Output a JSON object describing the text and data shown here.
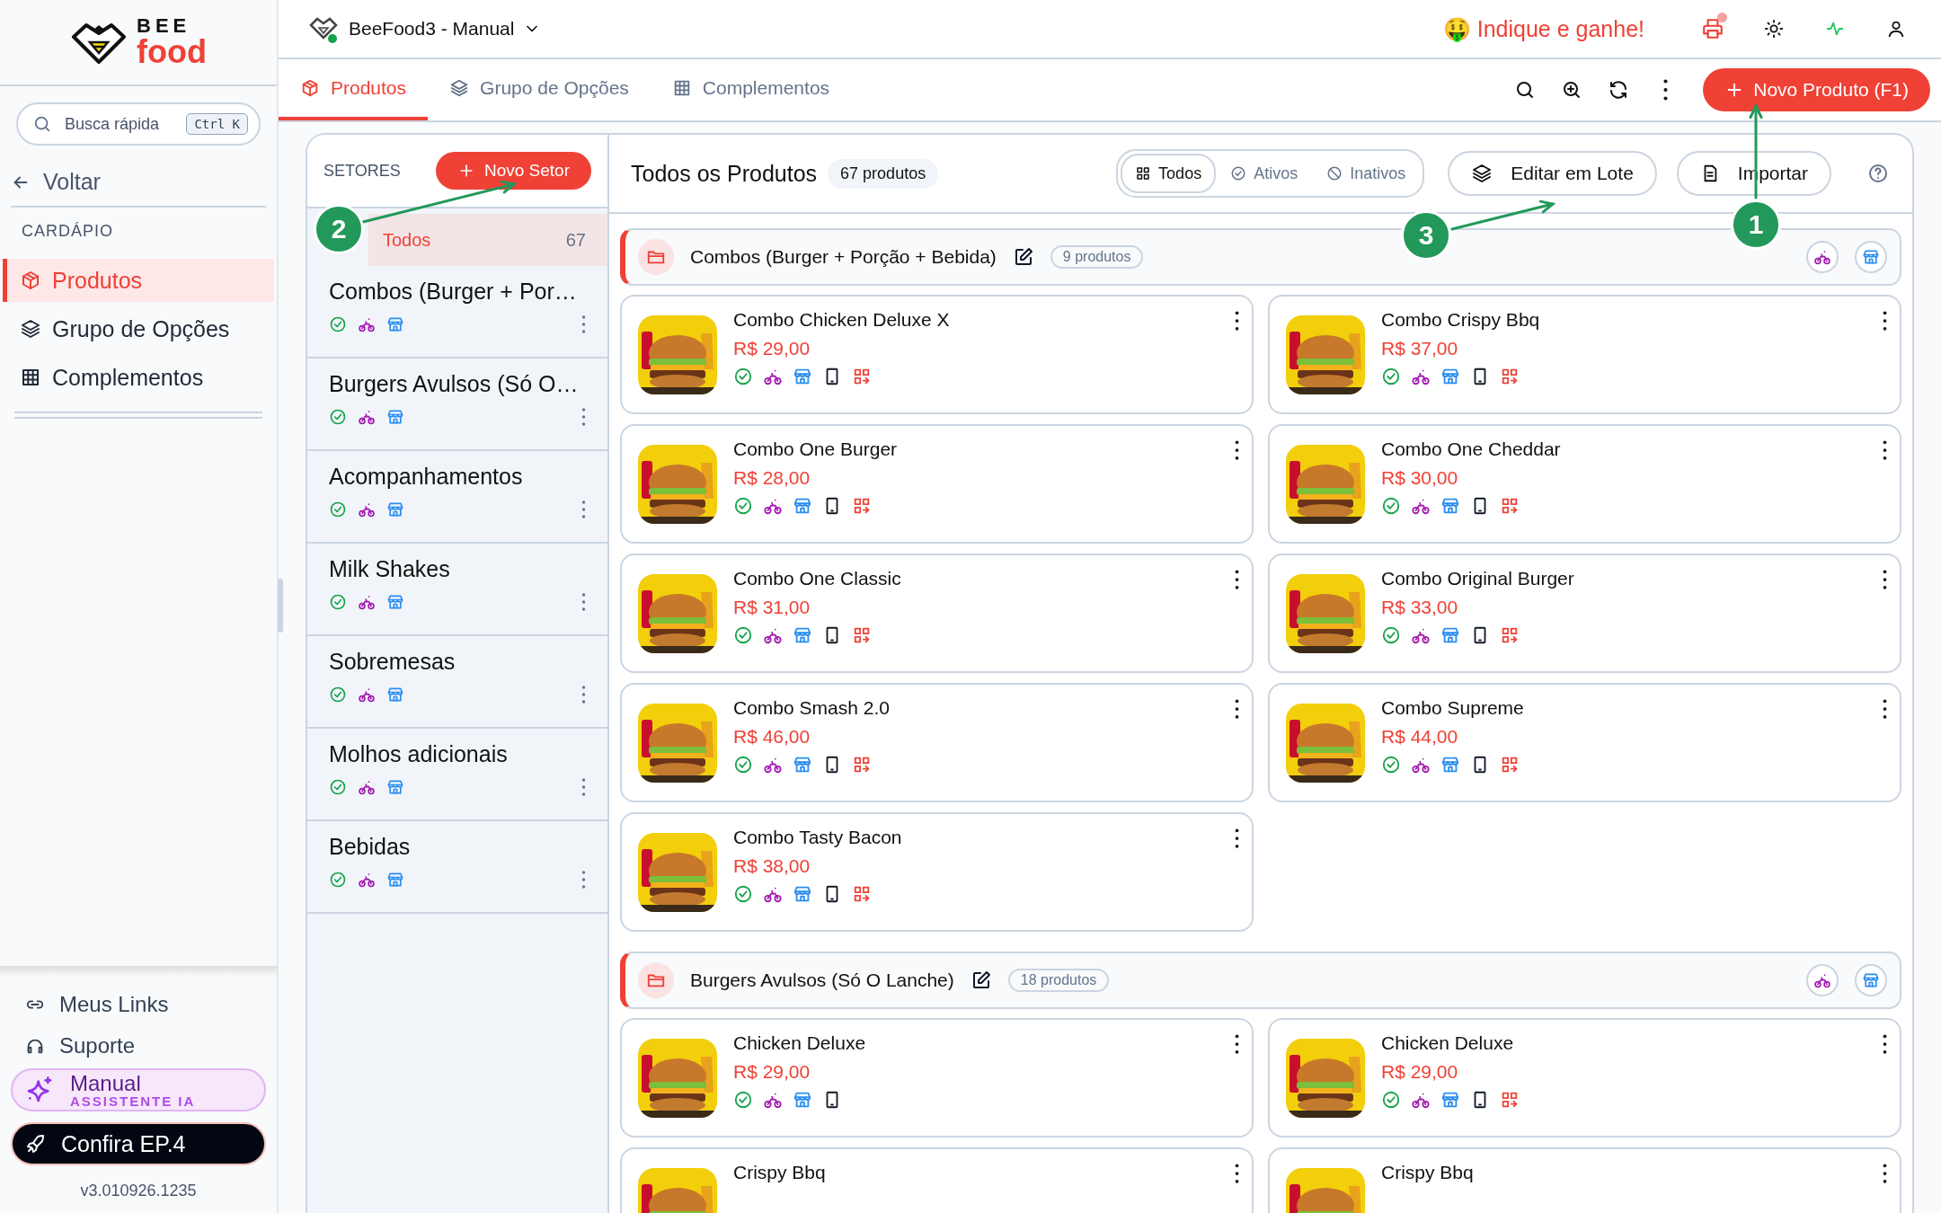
{
  "sidebar": {
    "logo": {
      "top": "BEE",
      "bottom": "food"
    },
    "search": {
      "placeholder": "Busca rápida",
      "shortcut": "Ctrl K"
    },
    "back": "Voltar",
    "section": "CARDÁPIO",
    "items": [
      {
        "label": "Produtos",
        "kind": "box",
        "selected": true
      },
      {
        "label": "Grupo de Opções",
        "kind": "layers",
        "selected": false
      },
      {
        "label": "Complementos",
        "kind": "grid",
        "selected": false
      }
    ],
    "footer_links": [
      {
        "label": "Meus Links",
        "kind": "link"
      },
      {
        "label": "Suporte",
        "kind": "headset"
      }
    ],
    "assistant": {
      "title": "Manual",
      "subtitle": "ASSISTENTE IA"
    },
    "promo": "Confira EP.4",
    "version": "v3.010926.1235"
  },
  "topbar": {
    "workspace": "BeeFood3 - Manual",
    "referral": "🤑 Indique e ganhe!",
    "printer_alert": true
  },
  "tabs": [
    {
      "label": "Produtos",
      "kind": "box",
      "selected": true
    },
    {
      "label": "Grupo de Opções",
      "kind": "layers",
      "selected": false
    },
    {
      "label": "Complementos",
      "kind": "grid",
      "selected": false
    }
  ],
  "new_product": "Novo Produto (F1)",
  "sectors": {
    "title": "SETORES",
    "new_button": "Novo Setor",
    "items": [
      {
        "kind": "all",
        "name": "Todos",
        "count": "67",
        "selected": true
      },
      {
        "kind": "sector",
        "name": "Combos (Burger + Por…",
        "selected": false
      },
      {
        "kind": "sector",
        "name": "Burgers Avulsos (Só O…",
        "selected": false
      },
      {
        "kind": "sector",
        "name": "Acompanhamentos",
        "selected": false
      },
      {
        "kind": "sector",
        "name": "Milk Shakes",
        "selected": false
      },
      {
        "kind": "sector",
        "name": "Sobremesas",
        "selected": false
      },
      {
        "kind": "sector",
        "name": "Molhos adicionais",
        "selected": false
      },
      {
        "kind": "sector",
        "name": "Bebidas",
        "selected": false
      }
    ]
  },
  "products_panel": {
    "title": "Todos os Produtos",
    "count": "67 produtos",
    "filters": [
      {
        "label": "Todos",
        "kind": "all",
        "selected": true
      },
      {
        "label": "Ativos",
        "kind": "active",
        "selected": false
      },
      {
        "label": "Inativos",
        "kind": "inactive",
        "selected": false
      }
    ],
    "batch_edit": "Editar em Lote",
    "import": "Importar"
  },
  "groups": [
    {
      "name": "Combos (Burger + Porção + Bebida)",
      "count": "9 produtos",
      "products": [
        {
          "name": "Combo Chicken Deluxe X",
          "price": "R$ 29,00",
          "swap_badge": true
        },
        {
          "name": "Combo Crispy Bbq",
          "price": "R$ 37,00",
          "swap_badge": true
        },
        {
          "name": "Combo One Burger",
          "price": "R$ 28,00",
          "swap_badge": true
        },
        {
          "name": "Combo One Cheddar",
          "price": "R$ 30,00",
          "swap_badge": true
        },
        {
          "name": "Combo One Classic",
          "price": "R$ 31,00",
          "swap_badge": true
        },
        {
          "name": "Combo Original Burger",
          "price": "R$ 33,00",
          "swap_badge": true
        },
        {
          "name": "Combo Smash 2.0",
          "price": "R$ 46,00",
          "swap_badge": true
        },
        {
          "name": "Combo Supreme",
          "price": "R$ 44,00",
          "swap_badge": true
        },
        {
          "name": "Combo Tasty Bacon",
          "price": "R$ 38,00",
          "swap_badge": true
        }
      ]
    },
    {
      "name": "Burgers Avulsos (Só O Lanche)",
      "count": "18 produtos",
      "products": [
        {
          "name": "Chicken Deluxe",
          "price": "R$ 29,00",
          "swap_badge": false
        },
        {
          "name": "Chicken Deluxe",
          "price": "R$ 29,00",
          "swap_badge": true
        },
        {
          "name": "Crispy Bbq"
        },
        {
          "name": "Crispy Bbq"
        }
      ]
    }
  ],
  "annotations": [
    {
      "label": "2"
    },
    {
      "label": "3"
    },
    {
      "label": "1"
    }
  ]
}
